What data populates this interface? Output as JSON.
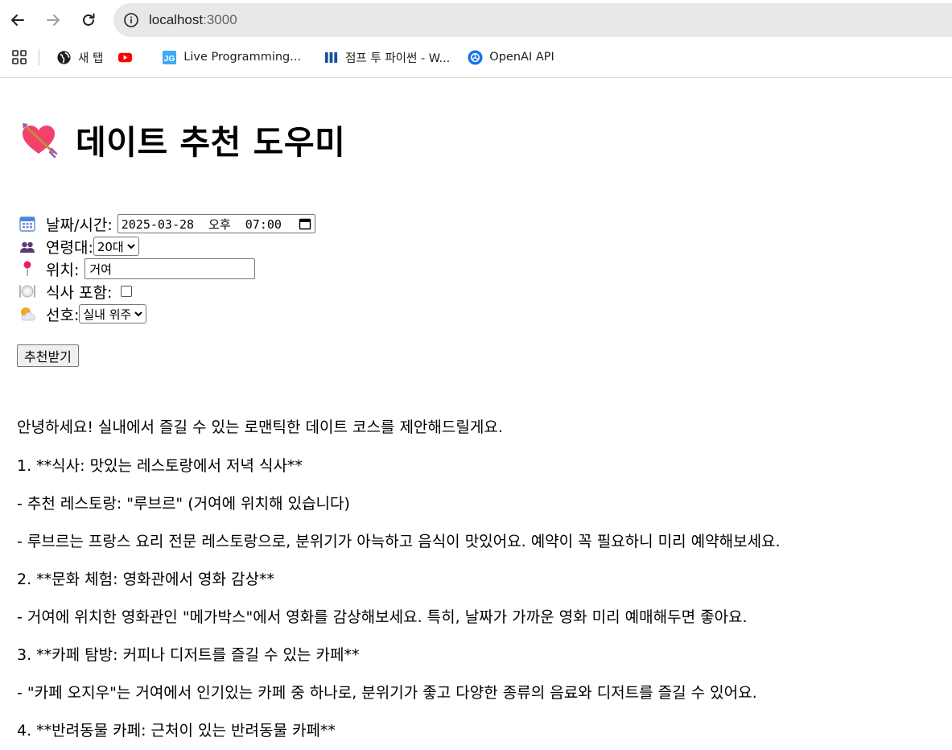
{
  "browser": {
    "url_host": "localhost",
    "url_port": ":3000",
    "bookmarks": [
      {
        "label": "새 탭",
        "icon": "globe-icon"
      },
      {
        "label": "",
        "icon": "youtube-icon"
      },
      {
        "label": "Live Programming...",
        "icon": "jg-icon"
      },
      {
        "label": "점프 투 파이썬 - W...",
        "icon": "wikidocs-icon"
      },
      {
        "label": "OpenAI API",
        "icon": "openai-icon"
      }
    ]
  },
  "page": {
    "title": "데이트 추천 도우미",
    "title_icon": "heart-arrow-icon"
  },
  "form": {
    "datetime_label": "날짜/시간:",
    "datetime_value": "2025-03-28  오후  07:00",
    "age_label": "연령대:",
    "age_value": "20대",
    "location_label": "위치:",
    "location_value": "거여",
    "meal_label": "식사 포함:",
    "meal_checked": false,
    "preference_label": "선호:",
    "preference_value": "실내 위주",
    "submit_label": "추천받기"
  },
  "result": {
    "lines": [
      "안녕하세요! 실내에서 즐길 수 있는 로맨틱한 데이트 코스를 제안해드릴게요.",
      "1. **식사: 맛있는 레스토랑에서 저녁 식사**",
      "- 추천 레스토랑: \"루브르\" (거여에 위치해 있습니다)",
      "- 루브르는 프랑스 요리 전문 레스토랑으로, 분위기가 아늑하고 음식이 맛있어요. 예약이 꼭 필요하니 미리 예약해보세요.",
      "2. **문화 체험: 영화관에서 영화 감상**",
      "- 거여에 위치한 영화관인 \"메가박스\"에서 영화를 감상해보세요. 특히, 날짜가 가까운 영화 미리 예매해두면 좋아요.",
      "3. **카페 탐방: 커피나 디저트를 즐길 수 있는 카페**",
      "- \"카페 오지우\"는 거여에서 인기있는 카페 중 하나로, 분위기가 좋고 다양한 종류의 음료와 디저트를 즐길 수 있어요.",
      "4. **반려동물 카페: 근처이 있는 반려동물 카페**"
    ]
  }
}
